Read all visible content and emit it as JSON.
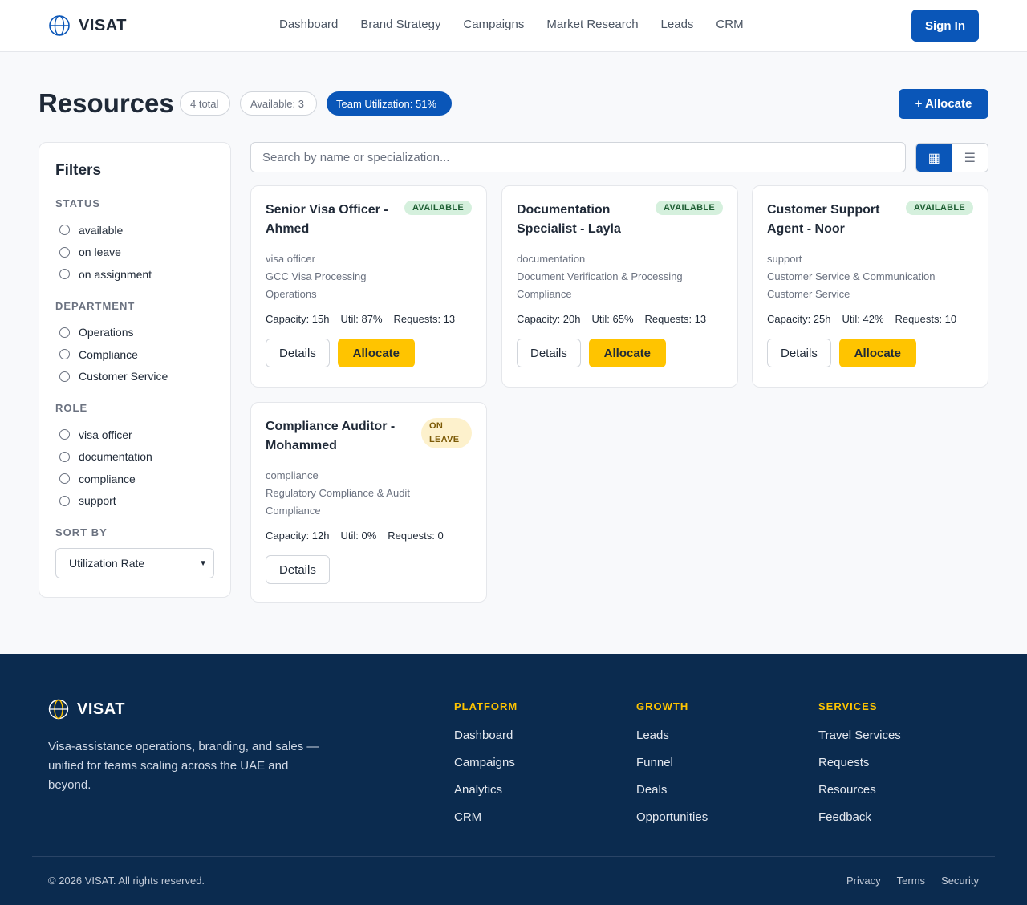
{
  "header": {
    "brand": "VISAT",
    "nav": [
      "Dashboard",
      "Brand Strategy",
      "Campaigns",
      "Market Research",
      "Leads",
      "CRM"
    ],
    "signin_label": "Sign In"
  },
  "page": {
    "title": "Resources",
    "total_pill": "4 total",
    "available_pill": "Available: 3",
    "utilization_pill": "Team Utilization: 51%",
    "allocate_label": "+ Allocate"
  },
  "filters": {
    "title": "Filters",
    "status": {
      "title": "Status",
      "options": [
        "available",
        "on leave",
        "on assignment"
      ]
    },
    "department": {
      "title": "Department",
      "options": [
        "Operations",
        "Compliance",
        "Customer Service"
      ]
    },
    "role": {
      "title": "Role",
      "options": [
        "visa officer",
        "documentation",
        "compliance",
        "support"
      ]
    },
    "sort": {
      "title": "Sort By",
      "selected": "Utilization Rate"
    }
  },
  "search": {
    "placeholder": "Search by name or specialization..."
  },
  "view_toggle": {
    "grid_icon": "grid-icon",
    "list_icon": "list-icon"
  },
  "cards": [
    {
      "title": "Senior Visa Officer - Ahmed",
      "status": "AVAILABLE",
      "role": "visa officer",
      "specialization": "GCC Visa Processing",
      "department": "Operations",
      "capacity": "Capacity: 15h",
      "util": "Util: 87%",
      "requests": "Requests: 13",
      "details_label": "Details",
      "allocate_label": "Allocate"
    },
    {
      "title": "Documentation Specialist - Layla",
      "status": "AVAILABLE",
      "role": "documentation",
      "specialization": "Document Verification & Processing",
      "department": "Compliance",
      "capacity": "Capacity: 20h",
      "util": "Util: 65%",
      "requests": "Requests: 13",
      "details_label": "Details",
      "allocate_label": "Allocate"
    },
    {
      "title": "Customer Support Agent - Noor",
      "status": "AVAILABLE",
      "role": "support",
      "specialization": "Customer Service & Communication",
      "department": "Customer Service",
      "capacity": "Capacity: 25h",
      "util": "Util: 42%",
      "requests": "Requests: 10",
      "details_label": "Details",
      "allocate_label": "Allocate"
    },
    {
      "title": "Compliance Auditor - Mohammed",
      "status": "ON LEAVE",
      "role": "compliance",
      "specialization": "Regulatory Compliance & Audit",
      "department": "Compliance",
      "capacity": "Capacity: 12h",
      "util": "Util: 0%",
      "requests": "Requests: 0",
      "details_label": "Details"
    }
  ],
  "footer": {
    "brand": "VISAT",
    "description": "Visa-assistance operations, branding, and sales — unified for teams scaling across the UAE and beyond.",
    "columns": [
      {
        "title": "Platform",
        "links": [
          "Dashboard",
          "Campaigns",
          "Analytics",
          "CRM"
        ]
      },
      {
        "title": "Growth",
        "links": [
          "Leads",
          "Funnel",
          "Deals",
          "Opportunities"
        ]
      },
      {
        "title": "Services",
        "links": [
          "Travel Services",
          "Requests",
          "Resources",
          "Feedback"
        ]
      }
    ],
    "copyright": "© 2026 VISAT. All rights reserved.",
    "legal": [
      "Privacy",
      "Terms",
      "Security"
    ]
  },
  "colors": {
    "primary": "#0a56b8",
    "accent": "#ffc400",
    "footer_bg": "#0b2b4f"
  }
}
